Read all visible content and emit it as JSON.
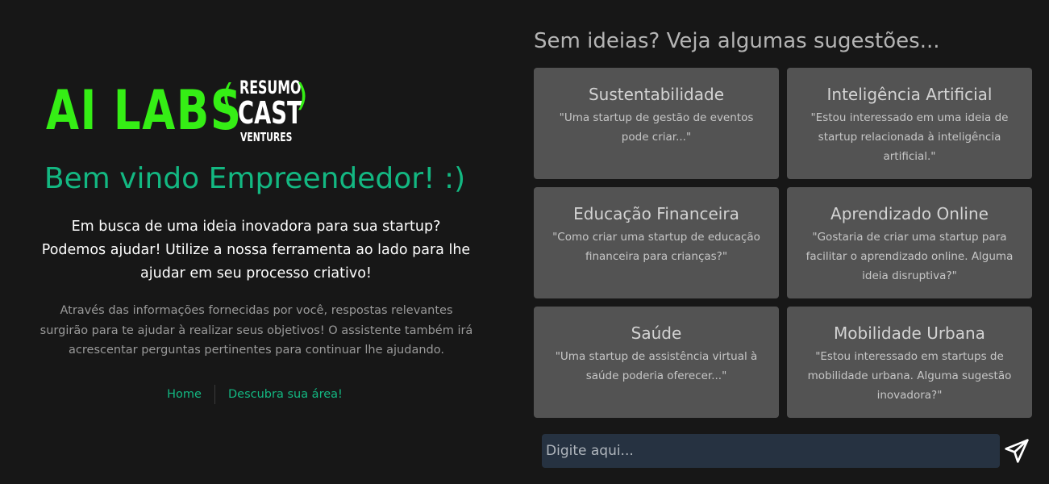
{
  "logo": {
    "brand": "AI LABS",
    "paren_open": "(",
    "paren_close": ")",
    "sub_top": "RESUMO",
    "sub_mid": "CAST",
    "sub_bottom": "VENTURES",
    "brand_color": "#35ee15"
  },
  "left": {
    "welcome": "Bem vindo Empreendedor! :)",
    "intro": "Em busca de uma ideia inovadora para sua startup? Podemos ajudar! Utilize a nossa ferramenta ao lado para lhe ajudar em seu processo criativo!",
    "description": "Através das informações fornecidas por você, respostas relevantes surgirão para te ajudar à realizar seus objetivos! O assistente também irá acrescentar perguntas pertinentes para continuar lhe ajudando.",
    "accent_color": "#13b882"
  },
  "nav": {
    "items": [
      {
        "label": "Home"
      },
      {
        "label": "Descubra sua área!"
      }
    ]
  },
  "suggestions": {
    "title": "Sem ideias? Veja algumas sugestões...",
    "cards": [
      {
        "title": "Sustentabilidade",
        "text": "\"Uma startup de gestão de eventos pode criar...\""
      },
      {
        "title": "Inteligência Artificial",
        "text": "\"Estou interessado em uma ideia de startup relacionada à inteligência artificial.\""
      },
      {
        "title": "Educação Financeira",
        "text": "\"Como criar uma startup de educação financeira para crianças?\""
      },
      {
        "title": "Aprendizado Online",
        "text": "\"Gostaria de criar uma startup para facilitar o aprendizado online. Alguma ideia disruptiva?\""
      },
      {
        "title": "Saúde",
        "text": "\"Uma startup de assistência virtual à saúde poderia oferecer...\""
      },
      {
        "title": "Mobilidade Urbana",
        "text": "\"Estou interessado em startups de mobilidade urbana. Alguma sugestão inovadora?\""
      }
    ]
  },
  "chat": {
    "placeholder": "Digite aqui...",
    "value": "",
    "send_icon": "paper-plane-icon"
  }
}
